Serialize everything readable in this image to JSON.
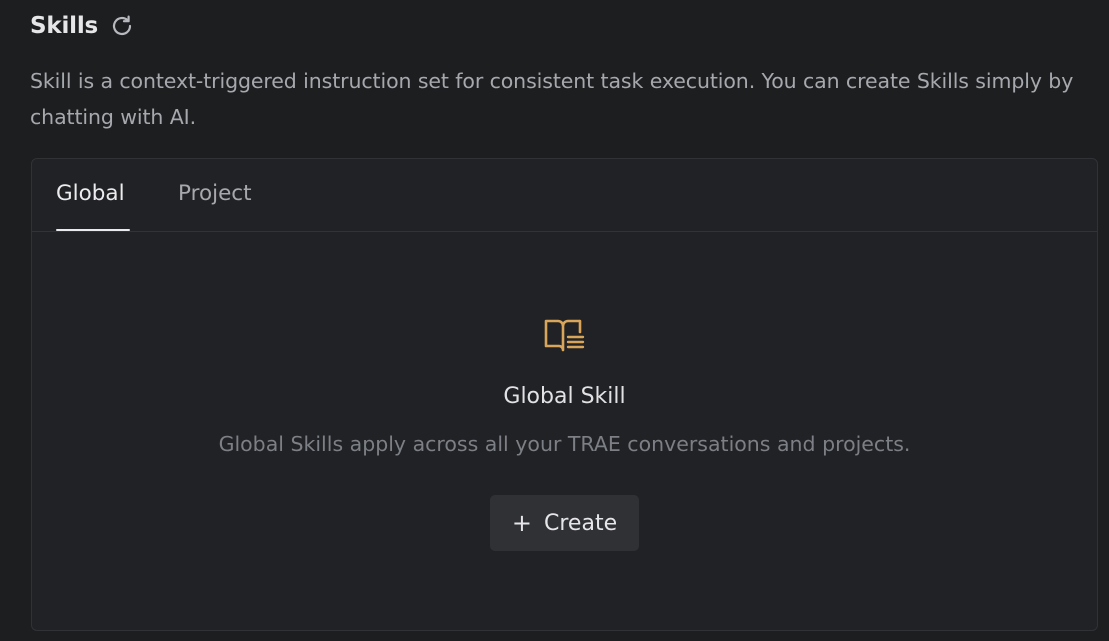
{
  "header": {
    "title": "Skills",
    "refresh_icon": "refresh-icon"
  },
  "description": "Skill is a context-triggered instruction set for consistent task execution. You can create Skills simply by chatting with AI.",
  "tabs": [
    {
      "label": "Global",
      "active": true
    },
    {
      "label": "Project",
      "active": false
    }
  ],
  "empty_state": {
    "icon": "book-icon",
    "icon_color": "#d9a55b",
    "title": "Global Skill",
    "description": "Global Skills apply across all your TRAE conversations and projects.",
    "create_button": {
      "icon": "plus-icon",
      "label": "Create"
    }
  }
}
